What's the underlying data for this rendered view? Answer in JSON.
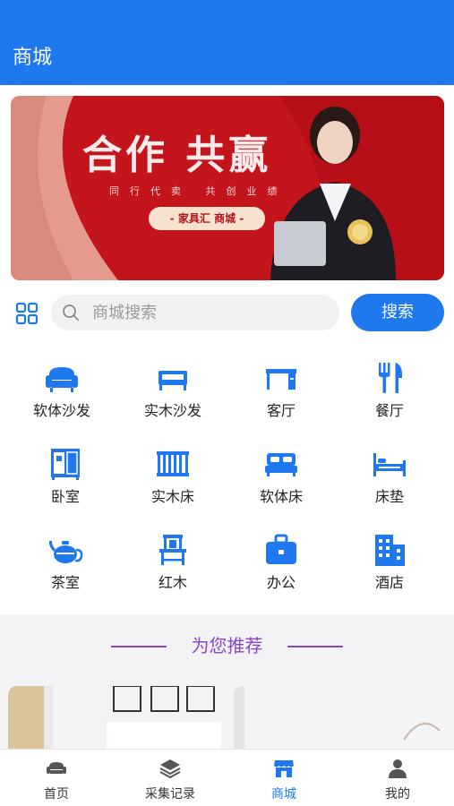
{
  "header": {
    "title": "商城"
  },
  "banner": {
    "headline": "合作 共赢",
    "tagline": "同行代卖 共创业绩",
    "pill": "- 家具汇 商城 -"
  },
  "search": {
    "placeholder": "商城搜索",
    "button_label": "搜索"
  },
  "categories": [
    {
      "label": "软体沙发",
      "icon": "sofa-icon"
    },
    {
      "label": "实木沙发",
      "icon": "wood-sofa-icon"
    },
    {
      "label": "客厅",
      "icon": "living-room-icon"
    },
    {
      "label": "餐厅",
      "icon": "dining-icon"
    },
    {
      "label": "卧室",
      "icon": "bedroom-icon"
    },
    {
      "label": "实木床",
      "icon": "wood-bed-icon"
    },
    {
      "label": "软体床",
      "icon": "soft-bed-icon"
    },
    {
      "label": "床垫",
      "icon": "mattress-icon"
    },
    {
      "label": "茶室",
      "icon": "teapot-icon"
    },
    {
      "label": "红木",
      "icon": "rosewood-chair-icon"
    },
    {
      "label": "办公",
      "icon": "briefcase-icon"
    },
    {
      "label": "酒店",
      "icon": "hotel-icon"
    }
  ],
  "recommend": {
    "title": "为您推荐"
  },
  "tabs": [
    {
      "label": "首页",
      "icon": "home-sofa-icon",
      "active": false
    },
    {
      "label": "采集记录",
      "icon": "layers-icon",
      "active": false
    },
    {
      "label": "商城",
      "icon": "store-icon",
      "active": true
    },
    {
      "label": "我的",
      "icon": "person-icon",
      "active": false
    }
  ],
  "colors": {
    "accent": "#1f78ee",
    "banner_red": "#c4141c",
    "recommend_purple": "#8b45c9"
  }
}
